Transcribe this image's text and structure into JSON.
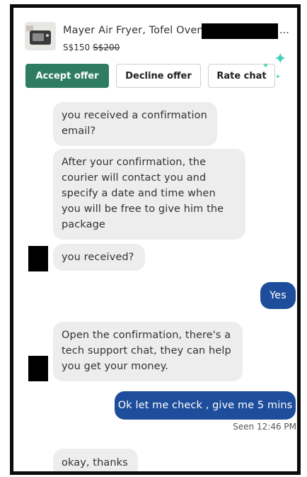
{
  "listing": {
    "title": "Mayer Air Fryer, Tofel Oven",
    "title_suffix": "...",
    "price": "S$150",
    "original_price": "S$200"
  },
  "actions": {
    "accept": "Accept offer",
    "decline": "Decline offer",
    "rate": "Rate chat"
  },
  "messages": [
    {
      "text": "you received a confirmation email?",
      "direction": "incoming"
    },
    {
      "text": "After your confirmation, the courier will contact you and specify a date and time when you will be free to give him the package",
      "direction": "incoming"
    },
    {
      "text": "you received?",
      "direction": "incoming"
    },
    {
      "text": "Yes",
      "direction": "outgoing"
    },
    {
      "text": "Open the confirmation, there's a tech support chat, they can help you get your money.",
      "direction": "incoming"
    },
    {
      "text": "Ok let me check , give me 5 mins",
      "direction": "outgoing"
    },
    {
      "text": "okay, thanks",
      "direction": "incoming"
    }
  ],
  "seen_status": "Seen 12:46 PM",
  "colors": {
    "accept_button": "#2e7d63",
    "outgoing_bubble": "#1e4e9b",
    "incoming_bubble": "#ededed",
    "sparkle": "#3fd1b9"
  },
  "icons": {
    "sparkle": "sparkle-icon"
  }
}
